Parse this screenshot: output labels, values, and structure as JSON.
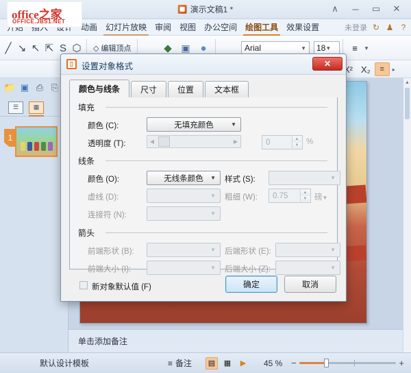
{
  "titlebar": {
    "document_title": "演示文稿1 *",
    "app_icon": "presentation-icon",
    "controls": {
      "collapse": "∧",
      "minimize": "─",
      "maximize": "▭",
      "close": "✕"
    }
  },
  "watermark": {
    "line1_a": "office",
    "line1_b": "之家",
    "line2": "OFFICE.JBS1.NET"
  },
  "menubar": {
    "items": [
      {
        "label": "开始",
        "state": "normal"
      },
      {
        "label": "插入",
        "state": "normal"
      },
      {
        "label": "设计",
        "state": "normal"
      },
      {
        "label": "动画",
        "state": "normal"
      },
      {
        "label": "幻灯片放映",
        "state": "underline"
      },
      {
        "label": "审阅",
        "state": "normal"
      },
      {
        "label": "视图",
        "state": "normal"
      },
      {
        "label": "办公空间",
        "state": "normal"
      },
      {
        "label": "绘图工具",
        "state": "active"
      },
      {
        "label": "效果设置",
        "state": "normal"
      }
    ],
    "not_logged_in": "未登录",
    "refresh_icon": "↻",
    "shirt_icon": "♟",
    "help_icon": "?"
  },
  "toolbar": {
    "shapes": [
      "╲",
      "↘",
      "↗",
      "⤡",
      "S",
      "⬡"
    ],
    "edit_vertex_label": "编辑顶点",
    "fill_icon": "paint-bucket-icon",
    "picture_icon": "picture-icon",
    "shape_preview_icon": "shape-ellipse-icon",
    "font_name": "Arial",
    "font_size": "18",
    "list_icon": "bullet-list-icon",
    "superscript": "X²",
    "subscript": "X₂",
    "align_icon": "align-left-icon"
  },
  "leftpanel": {
    "quick_icons": [
      "open-folder-icon",
      "save-icon",
      "print-icon",
      "print-preview-icon"
    ],
    "view_tabs": [
      {
        "name": "outline-view-tab",
        "selected": false
      },
      {
        "name": "slides-view-tab",
        "selected": true
      }
    ],
    "thumbnail_number": "1"
  },
  "notes": {
    "placeholder": "单击添加备注"
  },
  "statusbar": {
    "template_name": "默认设计模板",
    "notes_label": "备注",
    "view_normal": "normal-view-icon",
    "view_sorter": "slide-sorter-icon",
    "view_show": "slideshow-icon",
    "zoom_percent": "45 %",
    "zoom_out": "−",
    "zoom_in": "+"
  },
  "dialog": {
    "title": "设置对象格式",
    "icon": "format-object-icon",
    "close_label": "✕",
    "tabs": [
      {
        "label": "颜色与线条",
        "active": true
      },
      {
        "label": "尺寸",
        "active": false
      },
      {
        "label": "位置",
        "active": false
      },
      {
        "label": "文本框",
        "active": false
      }
    ],
    "fill": {
      "group_label": "填充",
      "color_label": "颜色 (C):",
      "color_value": "无填充颜色",
      "transparency_label": "透明度 (T):",
      "transparency_value": "0",
      "transparency_unit": "%"
    },
    "line": {
      "group_label": "线条",
      "color_label": "颜色 (O):",
      "color_value": "无线条颜色",
      "style_label": "样式 (S):",
      "style_value": "",
      "dash_label": "虚线 (D):",
      "dash_value": "",
      "weight_label": "粗细 (W):",
      "weight_value": "0.75",
      "weight_unit": "磅",
      "connector_label": "连接符 (N):",
      "connector_value": ""
    },
    "arrows": {
      "group_label": "箭头",
      "begin_style_label": "前端形状 (B):",
      "begin_style_value": "",
      "end_style_label": "后端形状 (E):",
      "end_style_value": "",
      "begin_size_label": "前端大小 (I):",
      "begin_size_value": "",
      "end_size_label": "后端大小 (Z):",
      "end_size_value": ""
    },
    "default_checkbox_label": "新对象默认值 (F)",
    "ok_label": "确定",
    "cancel_label": "取消"
  }
}
